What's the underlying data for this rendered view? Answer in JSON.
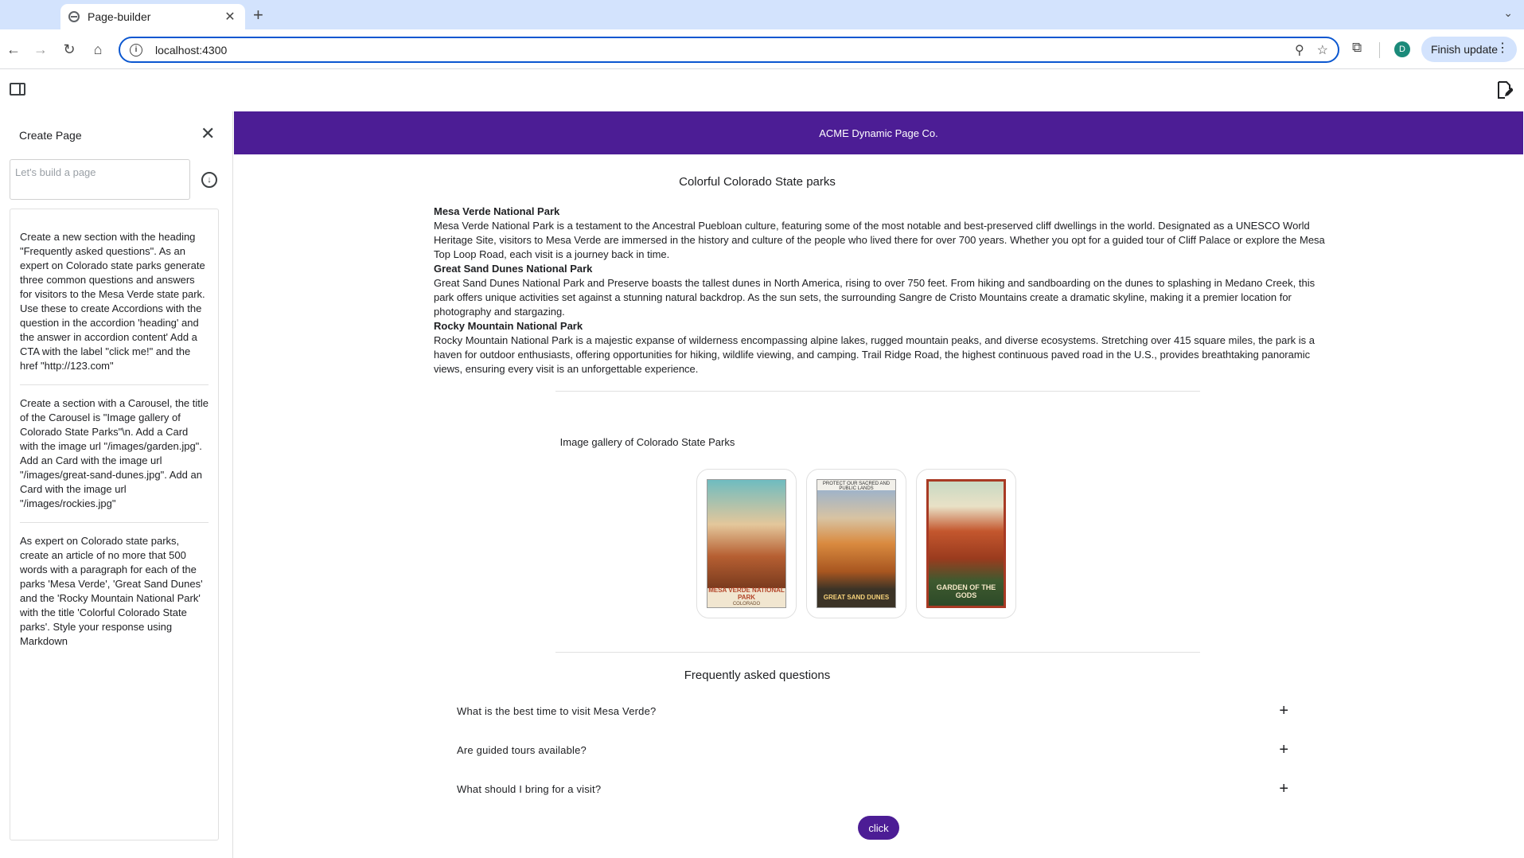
{
  "browser": {
    "tab_title": "Page-builder",
    "url": "localhost:4300",
    "profile_initial": "D",
    "finish_update_label": "Finish update"
  },
  "sidebar": {
    "title": "Create Page",
    "prompt_placeholder": "Let's build a page",
    "history": [
      "Create a new section with the heading \"Frequently asked questions\". As an expert on Colorado state parks generate three common questions and answers for visitors to the Mesa Verde state park. Use these to create Accordions with the question in the accordion 'heading' and the answer in accordion content' Add a CTA with the label \"click me!\" and the href \"http://123.com\"",
      "Create a section with a Carousel, the title of the Carousel is \"Image gallery of Colorado State Parks\"\\n. Add a Card with the image url \"/images/garden.jpg\". Add an Card with the image url \"/images/great-sand-dunes.jpg\". Add an Card with the image url \"/images/rockies.jpg\"",
      "As expert on Colorado state parks, create an article of no more that 500 words with a paragraph for each of the parks 'Mesa Verde', 'Great Sand Dunes' and the 'Rocky Mountain National Park' with the title 'Colorful Colorado State parks'. Style your response using Markdown"
    ]
  },
  "page": {
    "banner": "ACME Dynamic Page Co.",
    "article_title": "Colorful Colorado State parks",
    "parks": [
      {
        "name": "Mesa Verde National Park",
        "text": "Mesa Verde National Park is a testament to the Ancestral Puebloan culture, featuring some of the most notable and best-preserved cliff dwellings in the world. Designated as a UNESCO World Heritage Site, visitors to Mesa Verde are immersed in the history and culture of the people who lived there for over 700 years. Whether you opt for a guided tour of Cliff Palace or explore the Mesa Top Loop Road, each visit is a journey back in time."
      },
      {
        "name": "Great Sand Dunes National Park",
        "text": "Great Sand Dunes National Park and Preserve boasts the tallest dunes in North America, rising to over 750 feet. From hiking and sandboarding on the dunes to splashing in Medano Creek, this park offers unique activities set against a stunning natural backdrop. As the sun sets, the surrounding Sangre de Cristo Mountains create a dramatic skyline, making it a premier location for photography and stargazing."
      },
      {
        "name": "Rocky Mountain National Park",
        "text": "Rocky Mountain National Park is a majestic expanse of wilderness encompassing alpine lakes, rugged mountain peaks, and diverse ecosystems. Stretching over 415 square miles, the park is a haven for outdoor enthusiasts, offering opportunities for hiking, wildlife viewing, and camping. Trail Ridge Road, the highest continuous paved road in the U.S., provides breathtaking panoramic views, ensuring every visit is an unforgettable experience."
      }
    ],
    "gallery_title": "Image gallery of Colorado State Parks",
    "cards": [
      {
        "label": "MESA VERDE NATIONAL PARK",
        "sub": "COLORADO"
      },
      {
        "label": "GREAT SAND DUNES",
        "sub": "PROTECT OUR SACRED AND PUBLIC LANDS"
      },
      {
        "label": "GARDEN OF THE GODS",
        "sub": ""
      }
    ],
    "faq_title": "Frequently asked questions",
    "faq": [
      "What is the best time to visit Mesa Verde?",
      "Are guided tours available?",
      "What should I bring for a visit?"
    ],
    "cta_label": "click"
  }
}
